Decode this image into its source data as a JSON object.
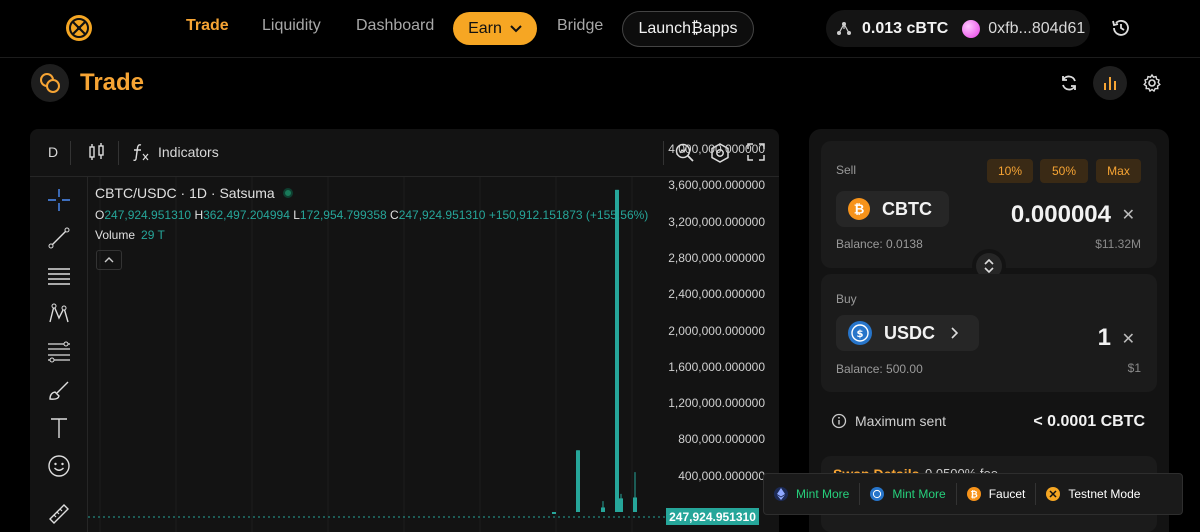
{
  "nav": {
    "items": [
      {
        "label": "Trade",
        "active": true
      },
      {
        "label": "Liquidity"
      },
      {
        "label": "Dashboard"
      },
      {
        "label": "Earn"
      },
      {
        "label": "Bridge"
      },
      {
        "label": "Launch₿apps"
      }
    ],
    "wallet_balance": "0.013 cBTC",
    "wallet_address": "0xfb...804d61"
  },
  "page": {
    "title": "Trade"
  },
  "chart_toolbar": {
    "interval": "D",
    "indicators_label": "Indicators"
  },
  "chart_legend": {
    "title": "CBTC/USDC · 1D · Satsuma",
    "o_label": "O",
    "o_value": "247,924.951310",
    "h_label": "H",
    "h_value": "362,497.204994",
    "l_label": "L",
    "l_value": "172,954.799358",
    "c_label": "C",
    "c_value": "247,924.951310",
    "change": "+150,912.151873 (+155.56%)",
    "volume_label": "Volume",
    "volume_value": "29 T"
  },
  "chart_data": {
    "type": "bar",
    "title": "CBTC/USDC · 1D · Satsuma",
    "y_ticks": [
      "4,000,000.000000",
      "3,600,000.000000",
      "3,200,000.000000",
      "2,800,000.000000",
      "2,400,000.000000",
      "2,000,000.000000",
      "1,600,000.000000",
      "1,200,000.000000",
      "800,000.000000",
      "400,000.000000"
    ],
    "ylim": [
      0,
      4000000
    ],
    "last_price": "247,924.951310",
    "candles": [
      {
        "open": 0,
        "close": 0,
        "high": 0,
        "low": 0
      },
      {
        "open": 680000,
        "close": 0,
        "high": 680000,
        "low": 0
      },
      {
        "open": 3550000,
        "close": 0,
        "high": 3550000,
        "low": 0
      },
      {
        "open": 50000,
        "close": 0,
        "high": 120000,
        "low": 0
      },
      {
        "open": 160000,
        "close": 0,
        "high": 440000,
        "low": 0
      },
      {
        "open": 150000,
        "close": 0,
        "high": 200000,
        "low": 0
      }
    ]
  },
  "swap": {
    "sell_label": "Sell",
    "pct_buttons": [
      "10%",
      "50%",
      "Max"
    ],
    "sell_token": "CBTC",
    "sell_amount": "0.000004",
    "sell_balance": "Balance: 0.0138",
    "sell_usd": "$11.32M",
    "buy_label": "Buy",
    "buy_token": "USDC",
    "buy_amount": "1",
    "buy_balance": "Balance: 500.00",
    "buy_usd": "$1",
    "max_sent_label": "Maximum sent",
    "max_sent_value": "< 0.0001 CBTC",
    "details_label": "Swap Details",
    "details_fee": "0.0500% fee"
  },
  "faucet_bar": [
    {
      "label": "Mint More",
      "color": "#26d07c"
    },
    {
      "label": "Mint More",
      "color": "#26d07c"
    },
    {
      "label": "Faucet",
      "color": "#ffffff"
    },
    {
      "label": "Testnet Mode",
      "color": "#ffffff"
    }
  ],
  "colors": {
    "accent": "#f6a434",
    "up": "#26a69a",
    "background": "#000000",
    "panel": "#131313"
  }
}
